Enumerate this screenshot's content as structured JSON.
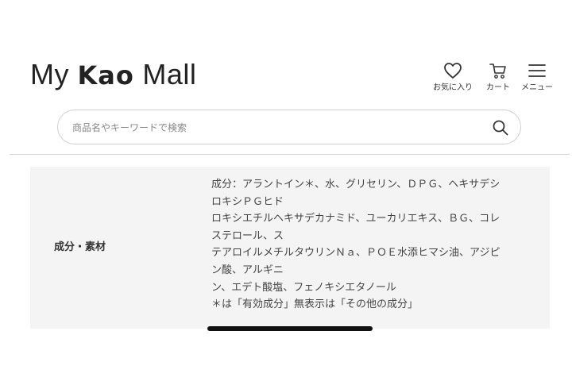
{
  "header": {
    "logo": {
      "prefix": "My ",
      "brand": "Kao",
      "suffix": " Mall"
    },
    "icons": [
      {
        "name": "heart-icon",
        "label": "お気に入り"
      },
      {
        "name": "cart-icon",
        "label": "カート"
      },
      {
        "name": "menu-icon",
        "label": "メニュー"
      }
    ]
  },
  "search": {
    "placeholder": "商品名やキーワードで検索",
    "value": ""
  },
  "spec_table": {
    "label": "成分・素材",
    "lines": [
      "成分：アラントイン＊、水、グリセリン、ＤＰＧ、ヘキサデシ",
      "ロキシＰＧヒド",
      "ロキシエチルヘキサデカナミド、ユーカリエキス、ＢＧ、コレ",
      "ステロール、ス",
      "テアロイルメチルタウリンＮａ、ＰＯＥ水添ヒマシ油、アジピ",
      "ン酸、アルギニ",
      "ン、エデト酸塩、フェノキシエタノール",
      "＊は「有効成分」無表示は「その他の成分」"
    ]
  },
  "colors": {
    "text": "#333333",
    "table_bg": "#f4f4f4",
    "border": "#cfcfcf",
    "home_indicator": "#111111"
  }
}
